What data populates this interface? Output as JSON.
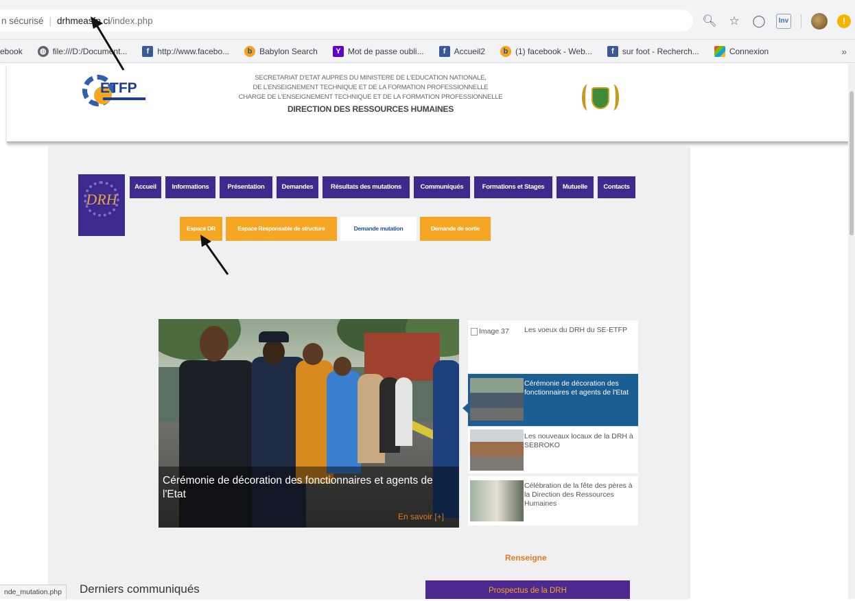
{
  "browser": {
    "security_label": "n sécurisé",
    "host": "drhmeasfp.ci",
    "path": "/index.php",
    "ext_label": "Inv",
    "bookmarks": [
      {
        "label": "ebook",
        "icon": "none"
      },
      {
        "label": "file:///D:/Document...",
        "icon": "globe-icon"
      },
      {
        "label": "http://www.facebo...",
        "icon": "facebook-icon"
      },
      {
        "label": "Babylon Search",
        "icon": "babylon-icon"
      },
      {
        "label": "Mot de passe oubli...",
        "icon": "yahoo-icon"
      },
      {
        "label": "Accueil2",
        "icon": "facebook-icon"
      },
      {
        "label": "(1) facebook - Web...",
        "icon": "babylon-icon"
      },
      {
        "label": "sur foot - Recherch...",
        "icon": "facebook-icon"
      },
      {
        "label": "Connexion",
        "icon": "windows-icon"
      }
    ],
    "more": "»",
    "status_url": "nde_mutation.php"
  },
  "header": {
    "logo_text": "ETFP",
    "lines": [
      "SECRETARIAT D'ETAT AUPRES DU MINISTERE DE L'EDUCATION NATIONALE,",
      "DE L'ENSEIGNEMENT TECHNIQUE ET DE LA FORMATION PROFESSIONNELLE",
      "CHARGE DE L'ENSEIGNEMENT TECHNIQUE ET DE LA FORMATION PROFESSIONNELLE"
    ],
    "direction": "DIRECTION DES RESSOURCES HUMAINES"
  },
  "drh_logo_text": "DRH",
  "menu": [
    "Accueil",
    "Informations",
    "Présentation",
    "Demandes",
    "Résultats des mutations",
    "Communiqués",
    "Formations et Stages",
    "Mutuelle",
    "Contacts"
  ],
  "submenu": [
    "Espace DR",
    "Espace Responsable de structure",
    "Demande mutation",
    "Demande de sortie"
  ],
  "slider": {
    "caption": "Cérémonie de décoration des fonctionnaires et agents de l'Etat",
    "more": "En savoir [+]"
  },
  "thumbs": [
    {
      "alt": "Image 37",
      "title": "Les voeux du DRH du SE-ETFP"
    },
    {
      "title": "Cérémonie de décoration des fonctionnaires et agents de l'Etat"
    },
    {
      "title": "Les nouveaux locaux de la DRH à SEBROKO"
    },
    {
      "title": "Célébration de la fête des pères à la Direction des Ressources Humaines"
    }
  ],
  "renseigne": "Renseigne",
  "prospectus": "Prospectus de la DRH",
  "derniers": "Derniers communiqués",
  "colors": {
    "menu_bg": "#3d2a8c",
    "submenu_bg": "#f5a623",
    "active_thumb": "#1b5e93",
    "accent_orange": "#e27b25"
  }
}
